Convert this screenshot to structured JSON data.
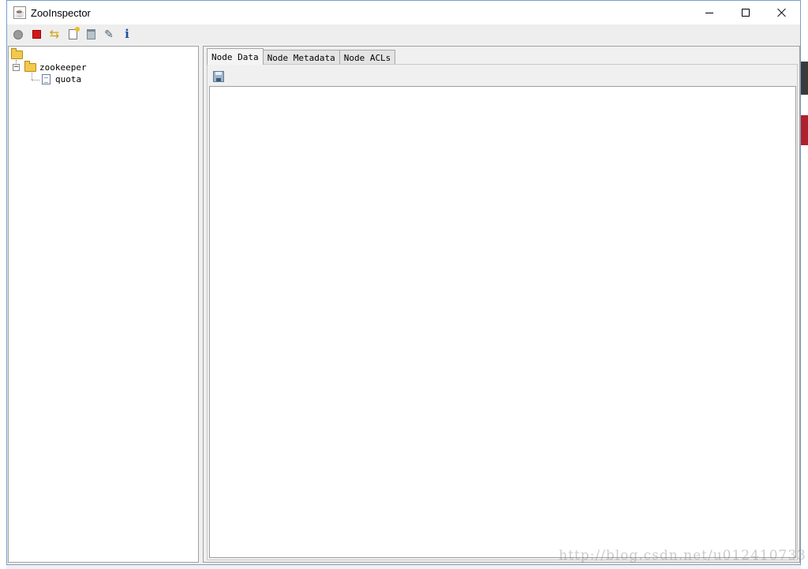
{
  "window": {
    "title": "ZooInspector",
    "controls": {
      "minimize": "minimize",
      "maximize": "maximize",
      "close": "close"
    }
  },
  "toolbar": {
    "buttons": [
      {
        "name": "connect",
        "icon": "connect-icon"
      },
      {
        "name": "disconnect",
        "icon": "disconnect-icon"
      },
      {
        "name": "refresh",
        "icon": "refresh-icon"
      },
      {
        "name": "add-node",
        "icon": "add-node-icon"
      },
      {
        "name": "delete-node",
        "icon": "delete-icon"
      },
      {
        "name": "settings",
        "icon": "settings-icon"
      },
      {
        "name": "about",
        "icon": "info-icon",
        "glyph": "i"
      }
    ]
  },
  "tree": {
    "root": {
      "icon": "folder-open-icon"
    },
    "nodes": [
      {
        "label": "zookeeper",
        "expanded": true,
        "icon": "folder-open-icon",
        "children": [
          {
            "label": "quota",
            "icon": "file-icon"
          }
        ]
      }
    ]
  },
  "tabs": [
    {
      "label": "Node Data",
      "active": true
    },
    {
      "label": "Node Metadata",
      "active": false
    },
    {
      "label": "Node ACLs",
      "active": false
    }
  ],
  "node_data": {
    "save_icon": "save-icon",
    "content": ""
  },
  "watermark": "http://blog.csdn.net/u012410733",
  "colors": {
    "title_bar": "#ffffff",
    "window_border": "#7a9ec8",
    "panel_bg": "#f0f0f0",
    "disconnect_red": "#d01818",
    "info_blue": "#1c4fa0"
  }
}
